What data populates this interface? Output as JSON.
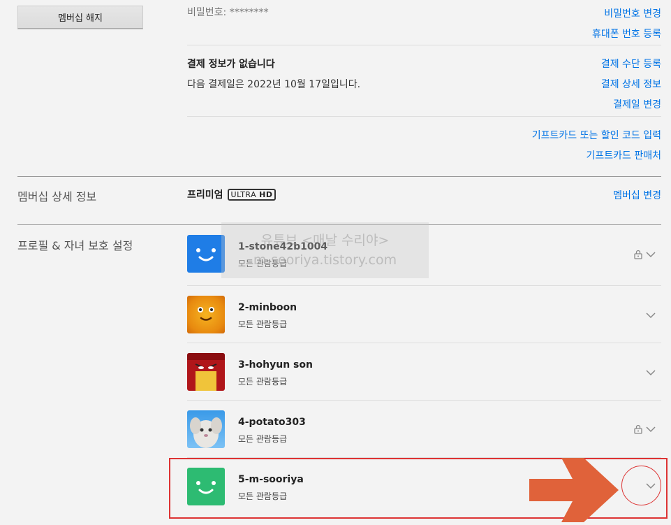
{
  "membership": {
    "cancel_button": "멤버십 해지"
  },
  "account": {
    "password_label": "비밀번호: ********",
    "change_password": "비밀번호 변경",
    "register_phone": "휴대폰 번호 등록"
  },
  "billing": {
    "no_payment_info": "결제 정보가 없습니다",
    "next_billing": "다음 결제일은 2022년 10월 17일입니다.",
    "register_payment": "결제 수단 등록",
    "billing_details": "결제 상세 정보",
    "change_billing_date": "결제일 변경",
    "redeem_gift": "기프트카드 또는 할인 코드 입력",
    "gift_sellers": "기프트카드 판매처"
  },
  "plan": {
    "section_label": "멤버십 상세 정보",
    "plan_name": "프리미엄",
    "badge_ultra": "ULTRA",
    "badge_hd": "HD",
    "change_plan": "멤버십 변경"
  },
  "profiles": {
    "section_label": "프로필 & 자녀 보호 설정",
    "items": [
      {
        "name": "1-stone42b1004",
        "rating": "모든 관람등급",
        "locked": true,
        "avatar": "blue-smile"
      },
      {
        "name": "2-minboon",
        "rating": "모든 관람등급",
        "locked": false,
        "avatar": "orange-face"
      },
      {
        "name": "3-hohyun son",
        "rating": "모든 관람등급",
        "locked": false,
        "avatar": "red-character"
      },
      {
        "name": "4-potato303",
        "rating": "모든 관람등급",
        "locked": true,
        "avatar": "white-creature"
      },
      {
        "name": "5-m-sooriya",
        "rating": "모든 관람등급",
        "locked": false,
        "avatar": "green-smile"
      }
    ]
  },
  "watermark": {
    "line1": "유튜브 <매날 수리야>",
    "line2": "m-sooriya.tistory.com"
  },
  "colors": {
    "link": "#0073e6",
    "background": "#f3f3f3",
    "annotation": "#dd3333",
    "arrow": "#e0623a"
  }
}
